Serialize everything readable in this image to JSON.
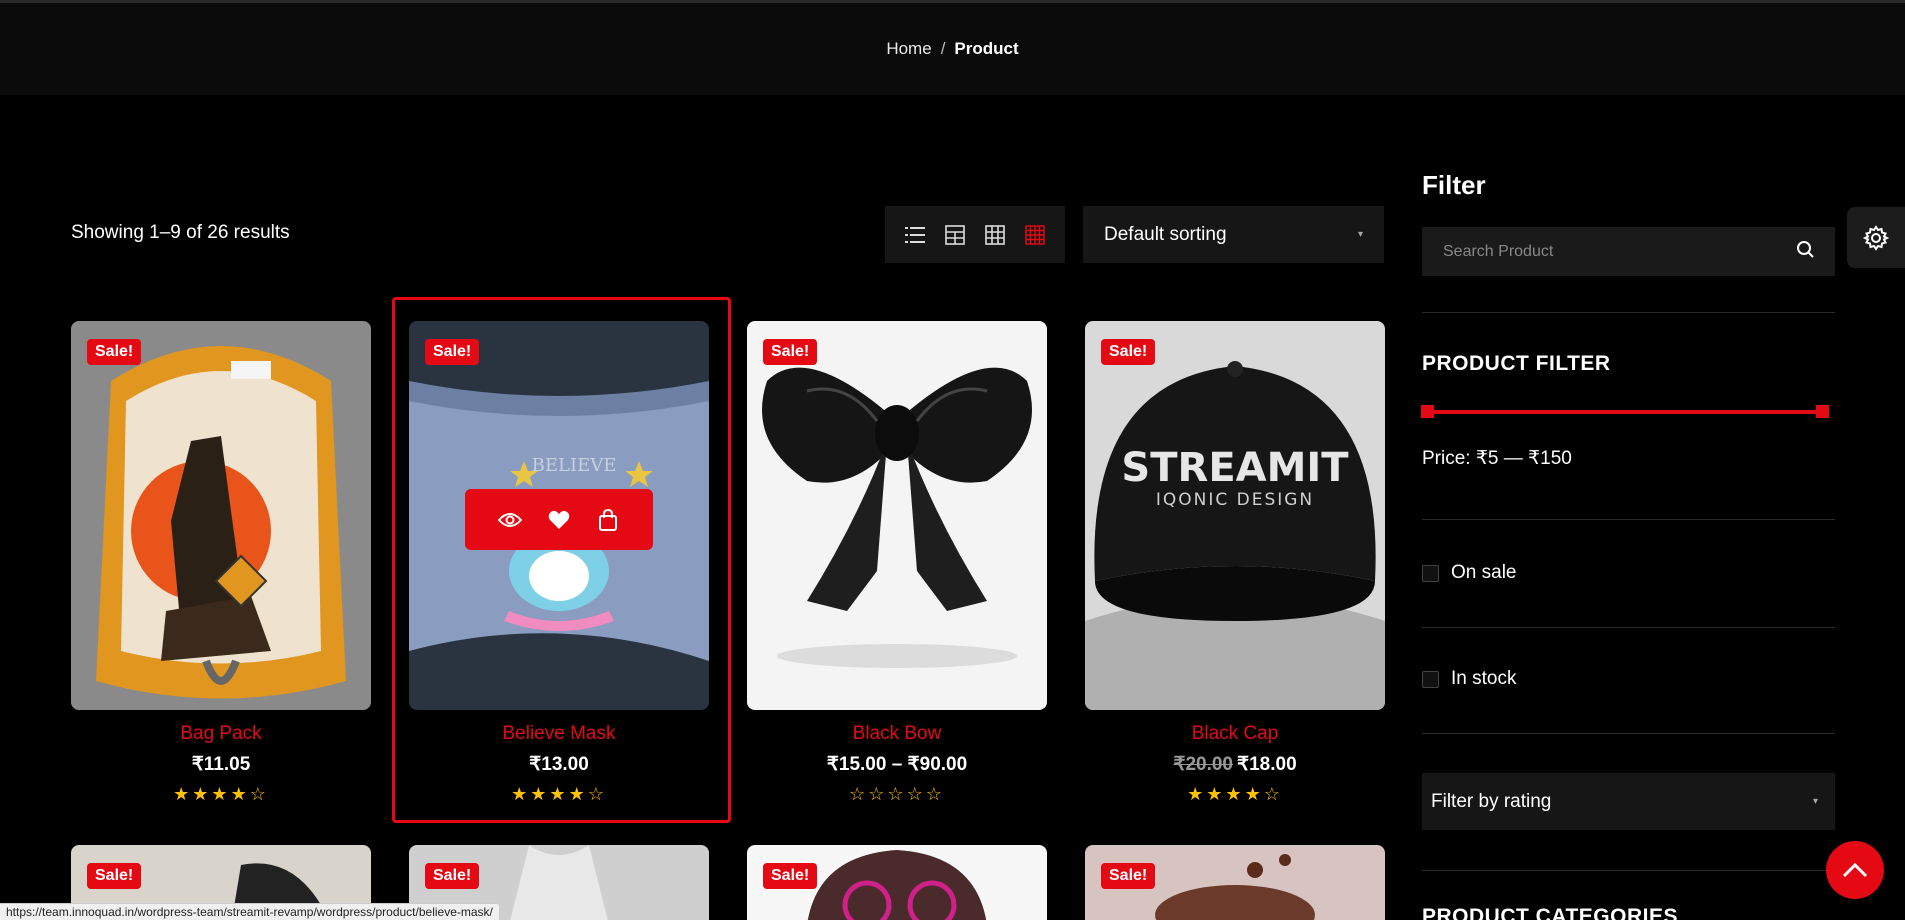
{
  "breadcrumb": {
    "home": "Home",
    "separator": "/",
    "current": "Product"
  },
  "results_text": "Showing 1–9 of 26 results",
  "view_modes": [
    "list-view-icon",
    "grid-2-icon",
    "grid-3-icon",
    "grid-4-icon"
  ],
  "sorting": {
    "selected": "Default sorting"
  },
  "products": [
    {
      "title": "Bag Pack",
      "price": "₹11.05",
      "old_price": "",
      "stars": "★★★★☆",
      "sale": "Sale!"
    },
    {
      "title": "Believe Mask",
      "price": "₹13.00",
      "old_price": "",
      "stars": "★★★★☆",
      "sale": "Sale!"
    },
    {
      "title": "Black Bow",
      "price": "₹15.00 – ₹90.00",
      "old_price": "",
      "stars": "☆☆☆☆☆",
      "sale": "Sale!"
    },
    {
      "title": "Black Cap",
      "price": "₹18.00",
      "old_price": "₹20.00",
      "stars": "★★★★☆",
      "sale": "Sale!"
    }
  ],
  "row2_badges": [
    "Sale!",
    "Sale!",
    "Sale!",
    "Sale!"
  ],
  "cap_text": {
    "line1": "STREAMIT",
    "line2": "IQONIC DESIGN"
  },
  "mask_text": "BELIEVE",
  "sidebar": {
    "filter_title": "Filter",
    "search_placeholder": "Search Product",
    "product_filter_title": "PRODUCT FILTER",
    "price_label": "Price: ₹5 — ₹150",
    "on_sale": "On sale",
    "in_stock": "In stock",
    "rating_select": "Filter by rating",
    "categories_title": "PRODUCT CATEGORIES"
  },
  "status_url": "https://team.innoquad.in/wordpress-team/streamit-revamp/wordpress/product/believe-mask/",
  "colors": {
    "accent": "#e50914",
    "star": "#ffc107",
    "background": "#000000",
    "panel": "#161616"
  }
}
